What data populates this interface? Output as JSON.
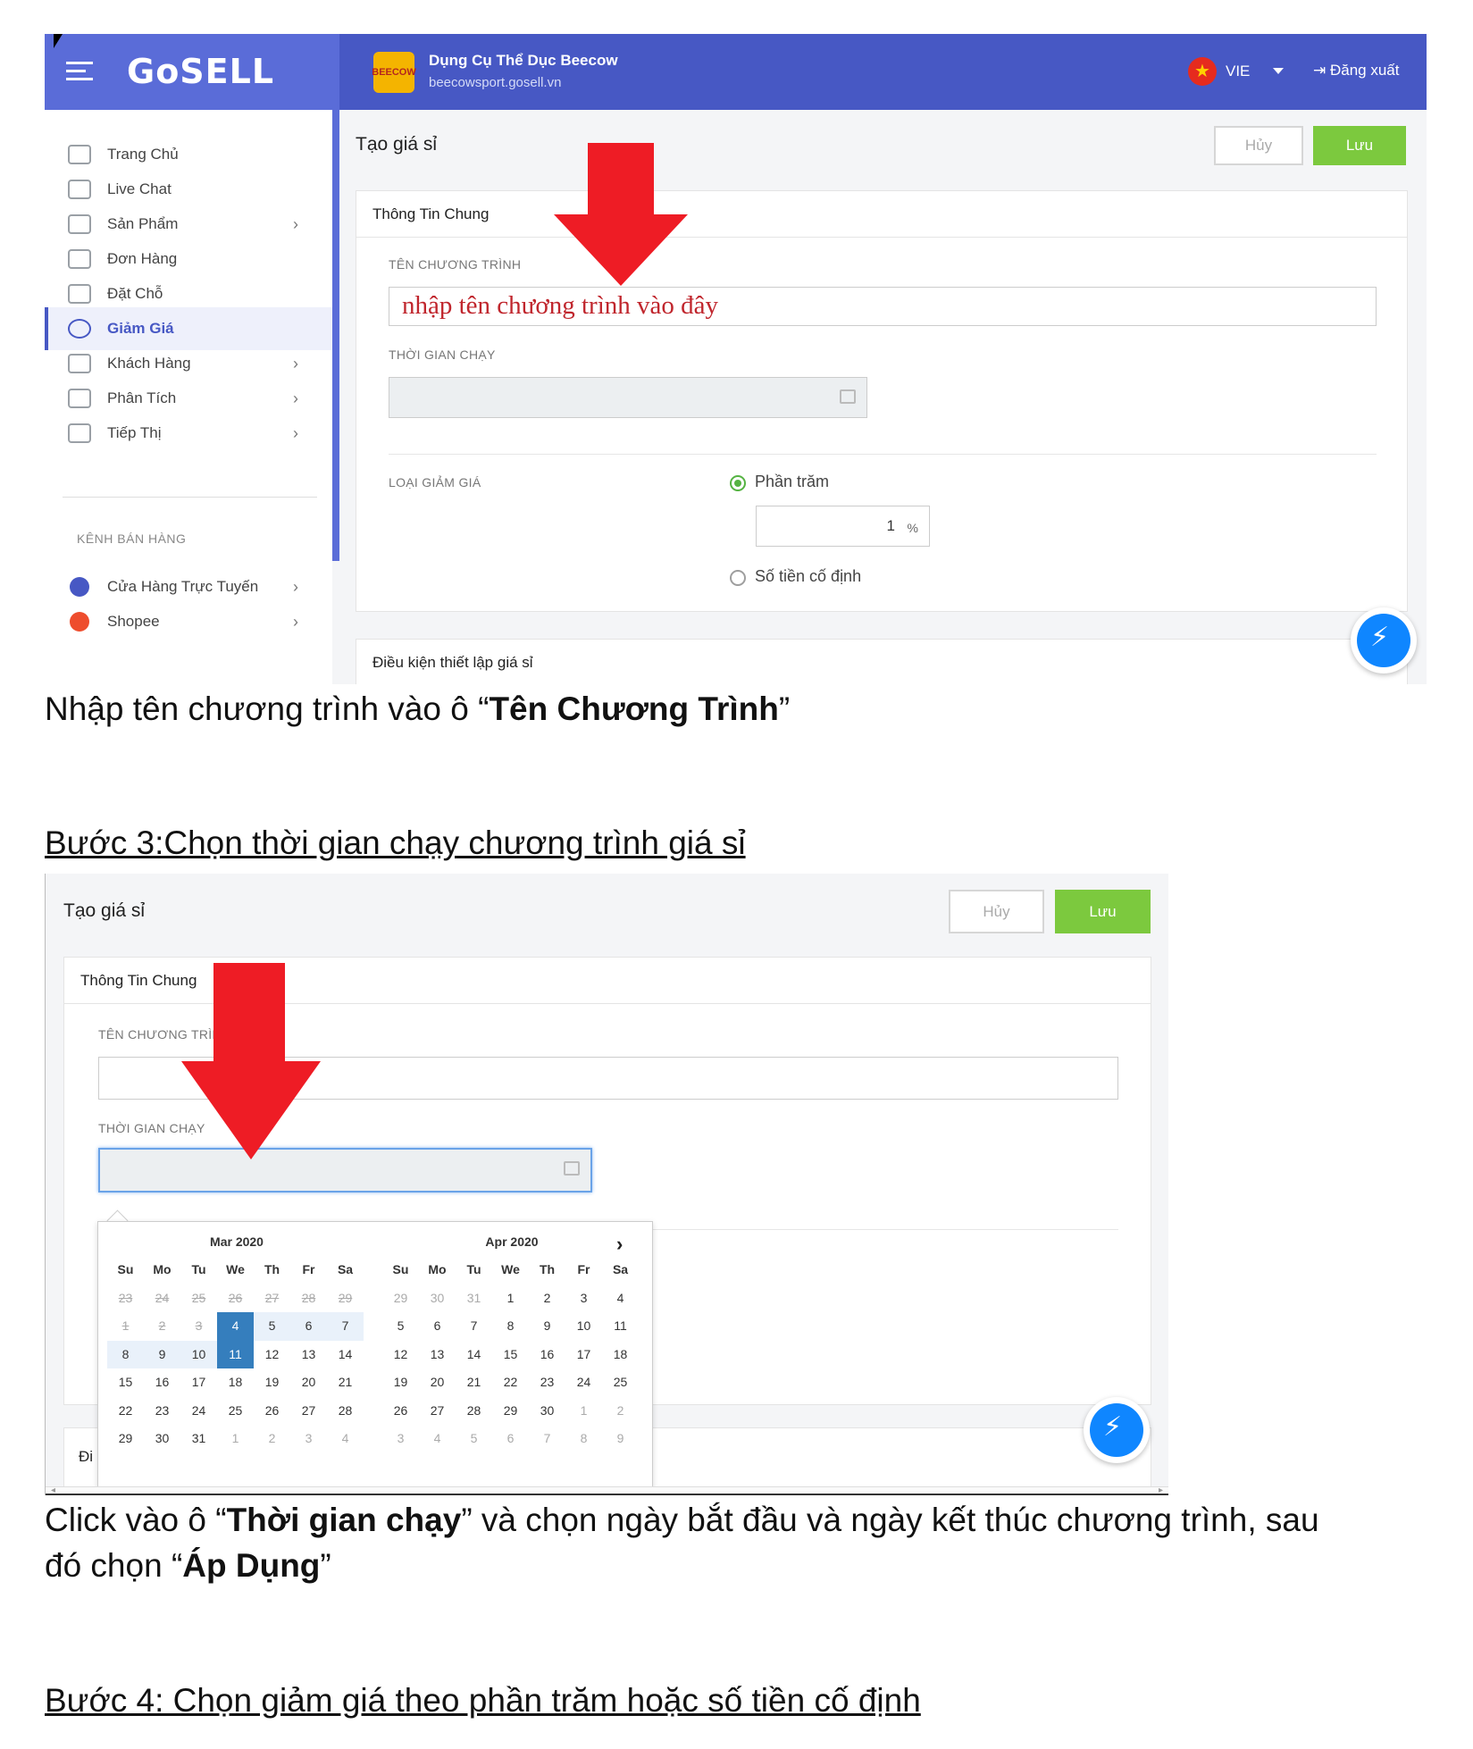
{
  "shot1": {
    "header": {
      "brand": "GoSELL",
      "store_logo_text": "BEECOW",
      "store_name": "Dụng Cụ Thể Dục Beecow",
      "store_url": "beecowsport.gosell.vn",
      "language": "VIE",
      "logout": "Đăng xuất"
    },
    "sidebar": {
      "items": [
        {
          "label": "Trang Chủ",
          "chevron": false
        },
        {
          "label": "Live Chat",
          "chevron": false
        },
        {
          "label": "Sản Phẩm",
          "chevron": true
        },
        {
          "label": "Đơn Hàng",
          "chevron": false
        },
        {
          "label": "Đặt Chỗ",
          "chevron": false
        },
        {
          "label": "Giảm Giá",
          "chevron": false,
          "active": true
        },
        {
          "label": "Khách Hàng",
          "chevron": true
        },
        {
          "label": "Phân Tích",
          "chevron": true
        },
        {
          "label": "Tiếp Thị",
          "chevron": true
        }
      ],
      "channels_header": "KÊNH BÁN HÀNG",
      "channels": [
        {
          "label": "Cửa Hàng Trực Tuyến",
          "color": "#4758c4"
        },
        {
          "label": "Shopee",
          "color": "#ee4d2d"
        }
      ]
    },
    "page_title": "Tạo giá sỉ",
    "cancel_label": "Hủy",
    "save_label": "Lưu",
    "card_title": "Thông Tin Chung",
    "program_name_label": "TÊN CHƯƠNG TRÌNH",
    "program_name_annotation": "nhập tên chương trình vào đây",
    "run_time_label": "THỜI GIAN CHẠY",
    "discount_type_label": "LOẠI GIẢM GIÁ",
    "option_percent": "Phần trăm",
    "percent_value": "1",
    "percent_unit": "%",
    "option_fixed": "Số tiền cố định",
    "conditions_title": "Điều kiện thiết lập giá sỉ"
  },
  "caption1": {
    "pre": "Nhập tên chương trình vào ô “",
    "bold": "Tên Chương Trình",
    "post": "”"
  },
  "step3_heading": "Bước 3:Chọn thời gian chạy chương trình giá sỉ ",
  "shot2": {
    "page_title": "Tạo giá sỉ",
    "cancel_label": "Hủy",
    "save_label": "Lưu",
    "card_title": "Thông Tin Chung",
    "program_name_label": "TÊN CHƯƠNG TRÌN",
    "run_time_label": "THỜI GIAN CHẠY",
    "bottom_card_title_partial": "Đi",
    "calendar": {
      "months": [
        {
          "title": "Mar 2020",
          "weeks": [
            [
              "23",
              "24",
              "25",
              "26",
              "27",
              "28",
              "29"
            ],
            [
              "1",
              "2",
              "3",
              "4",
              "5",
              "6",
              "7"
            ],
            [
              "8",
              "9",
              "10",
              "11",
              "12",
              "13",
              "14"
            ],
            [
              "15",
              "16",
              "17",
              "18",
              "19",
              "20",
              "21"
            ],
            [
              "22",
              "23",
              "24",
              "25",
              "26",
              "27",
              "28"
            ],
            [
              "29",
              "30",
              "31",
              "1",
              "2",
              "3",
              "4"
            ]
          ]
        },
        {
          "title": "Apr 2020",
          "weeks": [
            [
              "29",
              "30",
              "31",
              "1",
              "2",
              "3",
              "4"
            ],
            [
              "5",
              "6",
              "7",
              "8",
              "9",
              "10",
              "11"
            ],
            [
              "12",
              "13",
              "14",
              "15",
              "16",
              "17",
              "18"
            ],
            [
              "19",
              "20",
              "21",
              "22",
              "23",
              "24",
              "25"
            ],
            [
              "26",
              "27",
              "28",
              "29",
              "30",
              "1",
              "2"
            ],
            [
              "3",
              "4",
              "5",
              "6",
              "7",
              "8",
              "9"
            ]
          ]
        }
      ],
      "weekday_headers": [
        "Su",
        "Mo",
        "Tu",
        "We",
        "Th",
        "Fr",
        "Sa"
      ],
      "range_start": "4",
      "range_end": "11",
      "next_icon": "chevron-right-icon"
    }
  },
  "caption2": {
    "p1": "Click vào ô “",
    "b1": "Thời gian chạy",
    "p2": "” và chọn ngày bắt đầu và ngày kết thúc chương trình, sau",
    "p3": "đó chọn “",
    "b2": "Áp Dụng",
    "p4": "”"
  },
  "step4_heading": "Bước 4: Chọn giảm giá theo phần trăm hoặc số tiền cố định ",
  "colors": {
    "header": "#4758c4",
    "save": "#7cc93e",
    "arrow": "#ee1c25",
    "selected_day": "#357ebd"
  }
}
